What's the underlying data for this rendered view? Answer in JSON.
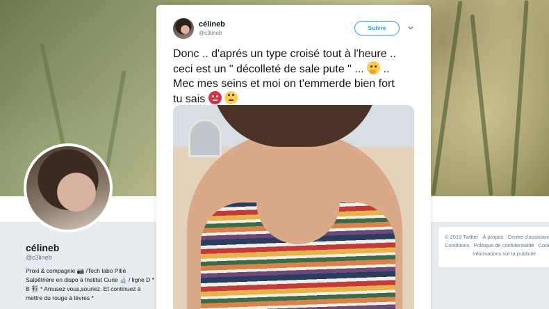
{
  "tweet": {
    "display_name": "célineb",
    "handle": "@c3lineb",
    "follow_label": "Suivre",
    "text_lines": [
      "Donc .. d'aprés un type croisé tout à l'heure ..",
      "ceci est un \" décolleté de sale pute \" ...",
      "..",
      "Mec mes seins et moi on t'emmerde bien fort",
      "tu sais"
    ]
  },
  "profile": {
    "name": "célineb",
    "handle": "@c3lineb",
    "bio": "Proxi & compagnie 📷 /Tech labo Pitié Salpêtrière en dispo à Institut Curie 🔬 / ligne D * B 👫 * Amusez vous,souriez. Et continuez à mettre du rouge à lèvres *"
  },
  "footer": {
    "links": [
      "© 2019 Twitter",
      "À propos",
      "Centre d'assistance",
      "Conditions",
      "Politique de confidentialité",
      "Cookies",
      "Informations sur la publicité"
    ]
  },
  "colors": {
    "accent": "#1da1f2",
    "text": "#14171a",
    "muted": "#657786"
  },
  "icons": {
    "emojis": [
      "thinking-face",
      "angry-face",
      "eye-roll-face"
    ],
    "caret": "chevron-down-icon"
  }
}
